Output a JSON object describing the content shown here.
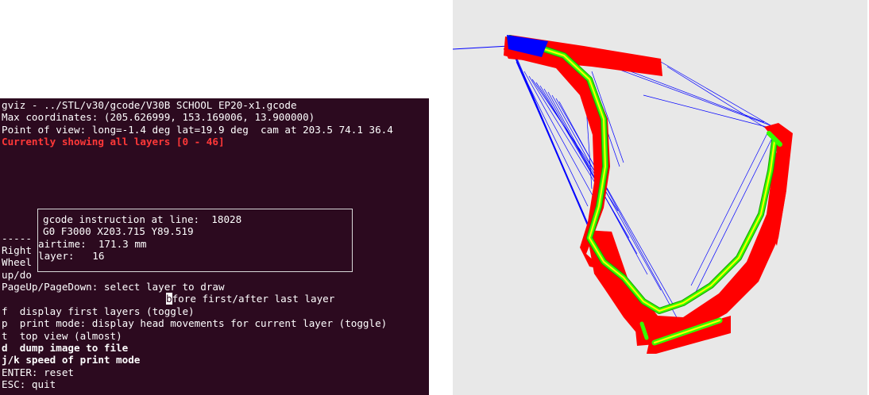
{
  "terminal": {
    "title": "gviz - ../STL/v30/gcode/V30B SCHOOL EP20-x1.gcode",
    "max_coordinates": "Max coordinates: (205.626999, 153.169006, 13.900000)",
    "point_of_view": "Point of view: long=-1.4 deg lat=19.9 deg  cam at 203.5 74.1 36.4",
    "layers_status": "Currently showing all layers [0 - 46]",
    "partial_lines": [
      "-----",
      "Right",
      "Wheel",
      "up/do"
    ],
    "pageup_help": "PageUp/PageDown: select layer to draw",
    "before_help_cursor_char": "b",
    "before_help_rest": "fore first/after last layer",
    "help_items": [
      {
        "key": "f",
        "text": "  display first layers (toggle)"
      },
      {
        "key": "p",
        "text": "  print mode: display head movements for current layer (toggle)"
      },
      {
        "key": "t",
        "text": "  top view (almost)"
      }
    ],
    "bold_items": [
      "d  dump image to file",
      "j/k speed of print mode"
    ],
    "tail_items": [
      "ENTER: reset",
      "ESC: quit"
    ]
  },
  "info_box": {
    "line_label": "gcode instruction at line:  18028",
    "instruction": "G0 F3000 X203.715 Y89.519",
    "airtime": "airtime:  171.3 mm",
    "layer": "layer:   16"
  },
  "colors": {
    "terminal_bg": "#2c0a1f",
    "status_red": "#ff3838",
    "viewport_bg": "#e8e8e8",
    "part_red": "#ff0000",
    "travel_blue": "#0000ff",
    "toolpath_green": "#33ff00",
    "toolpath_yellow": "#ffff00"
  }
}
